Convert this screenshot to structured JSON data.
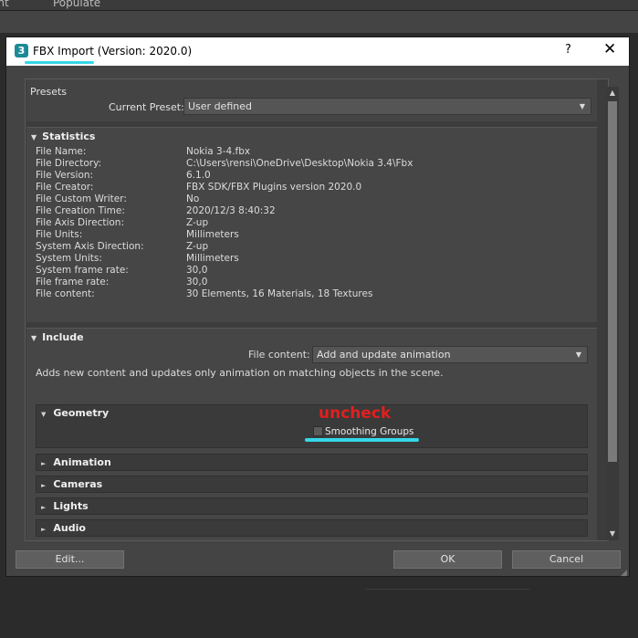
{
  "background": {
    "menu_left": "int",
    "menu_populate": "Populate"
  },
  "dialog": {
    "title": "FBX Import (Version: 2020.0)",
    "app_icon_glyph": "3",
    "help_glyph": "?",
    "close_glyph": "✕"
  },
  "presets": {
    "title": "Presets",
    "current_preset_label": "Current Preset:",
    "current_preset_value": "User defined"
  },
  "statistics": {
    "title": "Statistics",
    "rows": [
      {
        "label": "File Name:",
        "value": "Nokia 3-4.fbx"
      },
      {
        "label": "File Directory:",
        "value": "C:\\Users\\rensi\\OneDrive\\Desktop\\Nokia 3.4\\Fbx"
      },
      {
        "label": "File Version:",
        "value": "6.1.0"
      },
      {
        "label": "File Creator:",
        "value": "FBX SDK/FBX Plugins version 2020.0"
      },
      {
        "label": "File Custom Writer:",
        "value": "No"
      },
      {
        "label": "File Creation Time:",
        "value": "2020/12/3  8:40:32"
      },
      {
        "label": "File Axis Direction:",
        "value": "Z-up"
      },
      {
        "label": "File Units:",
        "value": "Millimeters"
      },
      {
        "label": "System Axis Direction:",
        "value": "Z-up"
      },
      {
        "label": "System Units:",
        "value": "Millimeters"
      },
      {
        "label": "System frame rate:",
        "value": "30,0"
      },
      {
        "label": "File frame rate:",
        "value": "30,0"
      },
      {
        "label": "File content:",
        "value": "30 Elements,   16 Materials,   18 Textures"
      }
    ]
  },
  "include": {
    "title": "Include",
    "file_content_label": "File content:",
    "file_content_value": "Add and update animation",
    "description": "Adds new content and updates only animation on matching objects in the scene.",
    "subsections": {
      "geometry": "Geometry",
      "animation": "Animation",
      "cameras": "Cameras",
      "lights": "Lights",
      "audio": "Audio"
    },
    "smoothing_groups_label": "Smoothing Groups",
    "smoothing_groups_checked": false
  },
  "annotation": {
    "text": "uncheck",
    "color": "#e41e1e",
    "highlight_color": "#35d7e8"
  },
  "buttons": {
    "edit": "Edit...",
    "ok": "OK",
    "cancel": "Cancel"
  }
}
